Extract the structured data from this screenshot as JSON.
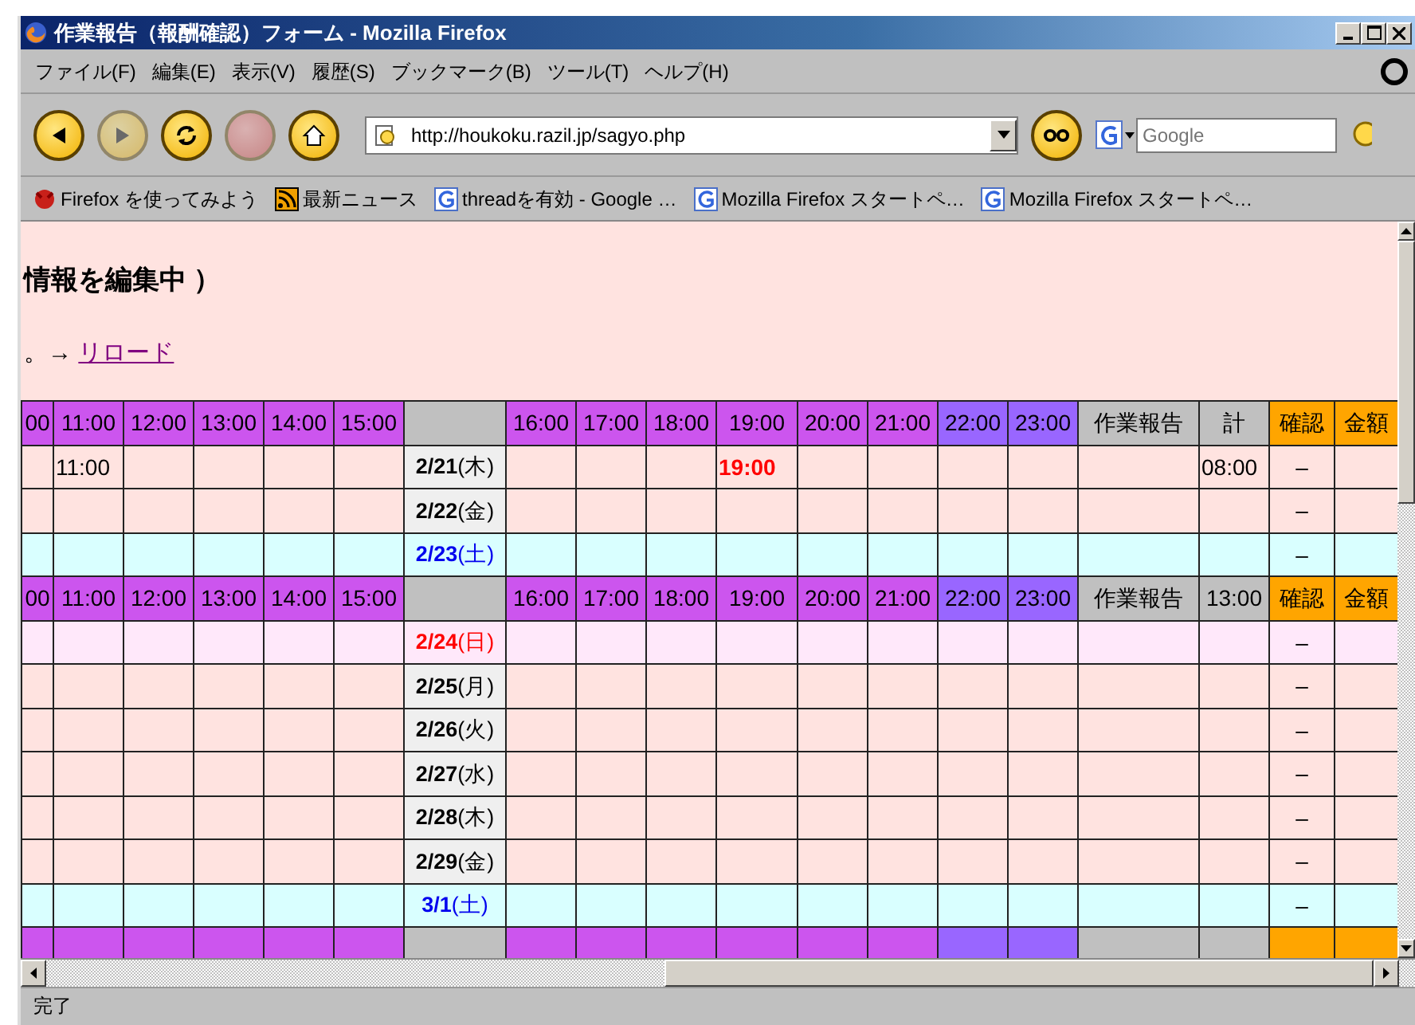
{
  "window": {
    "title": "作業報告（報酬確認）フォーム - Mozilla Firefox"
  },
  "menu": [
    "ファイル(F)",
    "編集(E)",
    "表示(V)",
    "履歴(S)",
    "ブックマーク(B)",
    "ツール(T)",
    "ヘルプ(H)"
  ],
  "toolbar": {
    "buttons": [
      {
        "kind": "back",
        "disabled": false
      },
      {
        "kind": "forward",
        "disabled": true
      },
      {
        "kind": "reload",
        "disabled": false
      },
      {
        "kind": "stop",
        "disabled": true
      },
      {
        "kind": "home",
        "disabled": false
      }
    ],
    "url": "http://houkoku.razil.jp/sagyo.php",
    "search": {
      "placeholder": "Google"
    }
  },
  "bookmarks": [
    {
      "kind": "firefox",
      "label": "Firefox を使ってみよう"
    },
    {
      "kind": "feed",
      "label": "最新ニュース"
    },
    {
      "kind": "google",
      "label": "threadを有効 - Google …"
    },
    {
      "kind": "google",
      "label": "Mozilla Firefox スタートペ…"
    },
    {
      "kind": "google",
      "label": "Mozilla Firefox スタートペ…"
    }
  ],
  "page": {
    "heading": "情報を編集中 ）",
    "notice": "。→",
    "reload_link": "リロード"
  },
  "table": {
    "rows": [
      {
        "kind": "header",
        "cells": [
          {
            "text": "00",
            "color": "#cc55ee"
          },
          {
            "text": "11:00",
            "color": "#cc55ee"
          },
          {
            "text": "12:00",
            "color": "#cc55ee"
          },
          {
            "text": "13:00",
            "color": "#cc55ee"
          },
          {
            "text": "14:00",
            "color": "#cc55ee"
          },
          {
            "text": "15:00",
            "color": "#cc55ee"
          },
          {
            "color": "#c0c0c0"
          },
          {
            "text": "16:00",
            "color": "#cc55ee"
          },
          {
            "text": "17:00",
            "color": "#cc55ee"
          },
          {
            "text": "18:00",
            "color": "#cc55ee"
          },
          {
            "text": "19:00",
            "color": "#cc55ee"
          },
          {
            "text": "20:00",
            "color": "#cc55ee"
          },
          {
            "text": "21:00",
            "color": "#cc55ee"
          },
          {
            "text": "22:00",
            "color": "#9966ff"
          },
          {
            "text": "23:00",
            "color": "#9966ff"
          },
          {
            "text": "作業報告",
            "color": "#c0c0c0"
          },
          {
            "text": "計",
            "color": "#c0c0c0"
          },
          {
            "text": "確認",
            "color": "#ffa500"
          },
          {
            "text": "金額",
            "color": "#ffa500"
          }
        ]
      },
      {
        "kind": "weekday",
        "cells": [
          {
            "kind": "blank"
          },
          {
            "kind": "plain",
            "text": "11:00"
          },
          {
            "kind": "blank"
          },
          {
            "kind": "blank"
          },
          {
            "kind": "blank"
          },
          {
            "kind": "blank"
          },
          {
            "kind": "date",
            "text": "**2/21**(木)"
          },
          {
            "kind": "blank"
          },
          {
            "kind": "blank"
          },
          {
            "kind": "blank"
          },
          {
            "kind": "alert",
            "text": "19:00"
          },
          {
            "kind": "blank"
          },
          {
            "kind": "blank"
          },
          {
            "kind": "blank"
          },
          {
            "kind": "blank"
          },
          {
            "kind": "blank"
          },
          {
            "kind": "plain",
            "text": "08:00"
          },
          {
            "kind": "center",
            "text": "–"
          },
          {
            "kind": "blank"
          }
        ]
      },
      {
        "kind": "weekday",
        "cells": [
          {
            "kind": "blank"
          },
          {
            "kind": "blank"
          },
          {
            "kind": "blank"
          },
          {
            "kind": "blank"
          },
          {
            "kind": "blank"
          },
          {
            "kind": "blank"
          },
          {
            "kind": "date",
            "text": "**2/22**(金)"
          },
          {
            "kind": "blank"
          },
          {
            "kind": "blank"
          },
          {
            "kind": "blank"
          },
          {
            "kind": "blank"
          },
          {
            "kind": "blank"
          },
          {
            "kind": "blank"
          },
          {
            "kind": "blank"
          },
          {
            "kind": "blank"
          },
          {
            "kind": "blank"
          },
          {
            "kind": "blank"
          },
          {
            "kind": "center",
            "text": "–"
          },
          {
            "kind": "blank"
          }
        ]
      },
      {
        "kind": "saturday",
        "cells": [
          {
            "kind": "blank"
          },
          {
            "kind": "blank"
          },
          {
            "kind": "blank"
          },
          {
            "kind": "blank"
          },
          {
            "kind": "blank"
          },
          {
            "kind": "blank"
          },
          {
            "kind": "date",
            "text": "**2/23**(土)"
          },
          {
            "kind": "blank"
          },
          {
            "kind": "blank"
          },
          {
            "kind": "blank"
          },
          {
            "kind": "blank"
          },
          {
            "kind": "blank"
          },
          {
            "kind": "blank"
          },
          {
            "kind": "blank"
          },
          {
            "kind": "blank"
          },
          {
            "kind": "blank"
          },
          {
            "kind": "blank"
          },
          {
            "kind": "center",
            "text": "–"
          },
          {
            "kind": "blank"
          }
        ]
      },
      {
        "kind": "header",
        "cells": [
          {
            "text": "00",
            "color": "#cc55ee"
          },
          {
            "text": "11:00",
            "color": "#cc55ee"
          },
          {
            "text": "12:00",
            "color": "#cc55ee"
          },
          {
            "text": "13:00",
            "color": "#cc55ee"
          },
          {
            "text": "14:00",
            "color": "#cc55ee"
          },
          {
            "text": "15:00",
            "color": "#cc55ee"
          },
          {
            "color": "#c0c0c0"
          },
          {
            "text": "16:00",
            "color": "#cc55ee"
          },
          {
            "text": "17:00",
            "color": "#cc55ee"
          },
          {
            "text": "18:00",
            "color": "#cc55ee"
          },
          {
            "text": "19:00",
            "color": "#cc55ee"
          },
          {
            "text": "20:00",
            "color": "#cc55ee"
          },
          {
            "text": "21:00",
            "color": "#cc55ee"
          },
          {
            "text": "22:00",
            "color": "#9966ff"
          },
          {
            "text": "23:00",
            "color": "#9966ff"
          },
          {
            "text": "作業報告",
            "color": "#c0c0c0"
          },
          {
            "text": "13:00",
            "color": "#c0c0c0"
          },
          {
            "text": "確認",
            "color": "#ffa500"
          },
          {
            "text": "金額",
            "color": "#ffa500"
          }
        ]
      },
      {
        "kind": "sunday",
        "cells": [
          {
            "kind": "blank"
          },
          {
            "kind": "blank"
          },
          {
            "kind": "blank"
          },
          {
            "kind": "blank"
          },
          {
            "kind": "blank"
          },
          {
            "kind": "blank"
          },
          {
            "kind": "date",
            "text": "**2/24**(日)"
          },
          {
            "kind": "blank"
          },
          {
            "kind": "blank"
          },
          {
            "kind": "blank"
          },
          {
            "kind": "blank"
          },
          {
            "kind": "blank"
          },
          {
            "kind": "blank"
          },
          {
            "kind": "blank"
          },
          {
            "kind": "blank"
          },
          {
            "kind": "blank"
          },
          {
            "kind": "blank"
          },
          {
            "kind": "center",
            "text": "–"
          },
          {
            "kind": "blank"
          }
        ]
      },
      {
        "kind": "weekday",
        "cells": [
          {
            "kind": "blank"
          },
          {
            "kind": "blank"
          },
          {
            "kind": "blank"
          },
          {
            "kind": "blank"
          },
          {
            "kind": "blank"
          },
          {
            "kind": "blank"
          },
          {
            "kind": "date",
            "text": "**2/25**(月)"
          },
          {
            "kind": "blank"
          },
          {
            "kind": "blank"
          },
          {
            "kind": "blank"
          },
          {
            "kind": "blank"
          },
          {
            "kind": "blank"
          },
          {
            "kind": "blank"
          },
          {
            "kind": "blank"
          },
          {
            "kind": "blank"
          },
          {
            "kind": "blank"
          },
          {
            "kind": "blank"
          },
          {
            "kind": "center",
            "text": "–"
          },
          {
            "kind": "blank"
          }
        ]
      },
      {
        "kind": "weekday",
        "cells": [
          {
            "kind": "blank"
          },
          {
            "kind": "blank"
          },
          {
            "kind": "blank"
          },
          {
            "kind": "blank"
          },
          {
            "kind": "blank"
          },
          {
            "kind": "blank"
          },
          {
            "kind": "date",
            "text": "**2/26**(火)"
          },
          {
            "kind": "blank"
          },
          {
            "kind": "blank"
          },
          {
            "kind": "blank"
          },
          {
            "kind": "blank"
          },
          {
            "kind": "blank"
          },
          {
            "kind": "blank"
          },
          {
            "kind": "blank"
          },
          {
            "kind": "blank"
          },
          {
            "kind": "blank"
          },
          {
            "kind": "blank"
          },
          {
            "kind": "center",
            "text": "–"
          },
          {
            "kind": "blank"
          }
        ]
      },
      {
        "kind": "weekday",
        "cells": [
          {
            "kind": "blank"
          },
          {
            "kind": "blank"
          },
          {
            "kind": "blank"
          },
          {
            "kind": "blank"
          },
          {
            "kind": "blank"
          },
          {
            "kind": "blank"
          },
          {
            "kind": "date",
            "text": "**2/27**(水)"
          },
          {
            "kind": "blank"
          },
          {
            "kind": "blank"
          },
          {
            "kind": "blank"
          },
          {
            "kind": "blank"
          },
          {
            "kind": "blank"
          },
          {
            "kind": "blank"
          },
          {
            "kind": "blank"
          },
          {
            "kind": "blank"
          },
          {
            "kind": "blank"
          },
          {
            "kind": "blank"
          },
          {
            "kind": "center",
            "text": "–"
          },
          {
            "kind": "blank"
          }
        ]
      },
      {
        "kind": "weekday",
        "cells": [
          {
            "kind": "blank"
          },
          {
            "kind": "blank"
          },
          {
            "kind": "blank"
          },
          {
            "kind": "blank"
          },
          {
            "kind": "blank"
          },
          {
            "kind": "blank"
          },
          {
            "kind": "date",
            "text": "**2/28**(木)"
          },
          {
            "kind": "blank"
          },
          {
            "kind": "blank"
          },
          {
            "kind": "blank"
          },
          {
            "kind": "blank"
          },
          {
            "kind": "blank"
          },
          {
            "kind": "blank"
          },
          {
            "kind": "blank"
          },
          {
            "kind": "blank"
          },
          {
            "kind": "blank"
          },
          {
            "kind": "blank"
          },
          {
            "kind": "center",
            "text": "–"
          },
          {
            "kind": "blank"
          }
        ]
      },
      {
        "kind": "weekday",
        "cells": [
          {
            "kind": "blank"
          },
          {
            "kind": "blank"
          },
          {
            "kind": "blank"
          },
          {
            "kind": "blank"
          },
          {
            "kind": "blank"
          },
          {
            "kind": "blank"
          },
          {
            "kind": "date",
            "text": "**2/29**(金)"
          },
          {
            "kind": "blank"
          },
          {
            "kind": "blank"
          },
          {
            "kind": "blank"
          },
          {
            "kind": "blank"
          },
          {
            "kind": "blank"
          },
          {
            "kind": "blank"
          },
          {
            "kind": "blank"
          },
          {
            "kind": "blank"
          },
          {
            "kind": "blank"
          },
          {
            "kind": "blank"
          },
          {
            "kind": "center",
            "text": "–"
          },
          {
            "kind": "blank"
          }
        ]
      },
      {
        "kind": "saturday",
        "cells": [
          {
            "kind": "blank"
          },
          {
            "kind": "blank"
          },
          {
            "kind": "blank"
          },
          {
            "kind": "blank"
          },
          {
            "kind": "blank"
          },
          {
            "kind": "blank"
          },
          {
            "kind": "date",
            "text": "**3/1**(土)"
          },
          {
            "kind": "blank"
          },
          {
            "kind": "blank"
          },
          {
            "kind": "blank"
          },
          {
            "kind": "blank"
          },
          {
            "kind": "blank"
          },
          {
            "kind": "blank"
          },
          {
            "kind": "blank"
          },
          {
            "kind": "blank"
          },
          {
            "kind": "blank"
          },
          {
            "kind": "blank"
          },
          {
            "kind": "center",
            "text": "–"
          },
          {
            "kind": "blank"
          }
        ]
      },
      {
        "kind": "header",
        "cells": [
          {
            "color": "#cc55ee"
          },
          {
            "color": "#cc55ee"
          },
          {
            "color": "#cc55ee"
          },
          {
            "color": "#cc55ee"
          },
          {
            "color": "#cc55ee"
          },
          {
            "color": "#cc55ee"
          },
          {
            "color": "#c0c0c0"
          },
          {
            "color": "#cc55ee"
          },
          {
            "color": "#cc55ee"
          },
          {
            "color": "#cc55ee"
          },
          {
            "color": "#cc55ee"
          },
          {
            "color": "#cc55ee"
          },
          {
            "color": "#cc55ee"
          },
          {
            "color": "#9966ff"
          },
          {
            "color": "#9966ff"
          },
          {
            "color": "#c0c0c0"
          },
          {
            "color": "#c0c0c0"
          },
          {
            "color": "#ffa500"
          },
          {
            "color": "#ffa500"
          }
        ]
      }
    ]
  },
  "status_bar": "完了"
}
